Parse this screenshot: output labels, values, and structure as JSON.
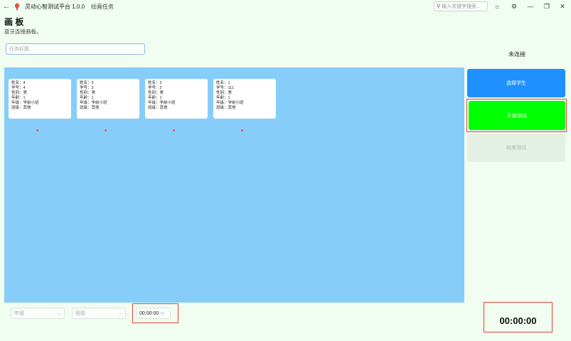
{
  "titlebar": {
    "back_icon": "arrow-left-icon",
    "app_title": "灵动心智测试平台 1.0.0",
    "page_tab": "绘画任务",
    "search_placeholder": "输入关键字搜索...",
    "icons": [
      "sun-icon",
      "gear-icon",
      "minimize-icon",
      "restore-icon",
      "close-icon"
    ]
  },
  "header": {
    "title": "画 板",
    "subtitle": "蓝牙连接画板。"
  },
  "task_input": {
    "placeholder": "任务标题",
    "value": ""
  },
  "connection_status": "未连接",
  "students": [
    {
      "name": "姓名：4",
      "id": "学号：4",
      "gender": "性别：男",
      "age": "年龄：1",
      "grade": "年级：学前小班",
      "class": "班级：其他"
    },
    {
      "name": "姓名：3",
      "id": "学号：3",
      "gender": "性别：男",
      "age": "年龄：1",
      "grade": "年级：学前小班",
      "class": "班级：其他"
    },
    {
      "name": "姓名：2",
      "id": "学号：2",
      "gender": "性别：男",
      "age": "年龄：1",
      "grade": "年级：学前小班",
      "class": "班级：其他"
    },
    {
      "name": "姓名：1",
      "id": "学号：111",
      "gender": "性别：男",
      "age": "年龄：1",
      "grade": "年级：学前小班",
      "class": "班级：其他"
    }
  ],
  "buttons": {
    "select_student": "选择学生",
    "start_test": "开始测试",
    "end_test": "结束测试"
  },
  "filters": {
    "grade_placeholder": "年级",
    "class_placeholder": "班级"
  },
  "timer_small": "00:00:00",
  "timer_big": "00:00:00",
  "colors": {
    "background": "#f0fdf0",
    "canvas": "#87cdfa",
    "select_button": "#1e90ff",
    "start_button": "#00ff00",
    "highlight_border": "#e8433a",
    "status_dot": "#ff4a4a"
  }
}
